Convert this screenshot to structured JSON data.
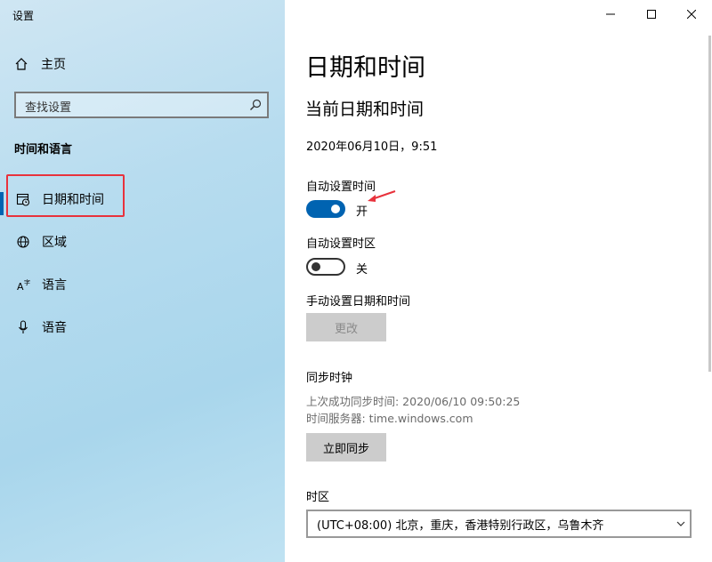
{
  "window": {
    "title": "设置"
  },
  "sidebar": {
    "home_label": "主页",
    "search_placeholder": "查找设置",
    "section_title": "时间和语言",
    "items": [
      {
        "label": "日期和时间",
        "icon": "calendar-clock-icon",
        "active": true
      },
      {
        "label": "区域",
        "icon": "globe-icon"
      },
      {
        "label": "语言",
        "icon": "language-icon"
      },
      {
        "label": "语音",
        "icon": "microphone-icon"
      }
    ]
  },
  "main": {
    "title": "日期和时间",
    "subtitle": "当前日期和时间",
    "current_datetime": "2020年06月10日，9:51",
    "auto_time": {
      "label": "自动设置时间",
      "state": "开"
    },
    "auto_timezone": {
      "label": "自动设置时区",
      "state": "关"
    },
    "manual": {
      "label": "手动设置日期和时间",
      "button": "更改"
    },
    "sync": {
      "title": "同步时钟",
      "last_sync": "上次成功同步时间: 2020/06/10 09:50:25",
      "server": "时间服务器: time.windows.com",
      "button": "立即同步"
    },
    "timezone": {
      "label": "时区",
      "value": "(UTC+08:00) 北京，重庆，香港特别行政区，乌鲁木齐"
    }
  },
  "colors": {
    "accent": "#0063b1",
    "highlight": "#e8323c"
  }
}
